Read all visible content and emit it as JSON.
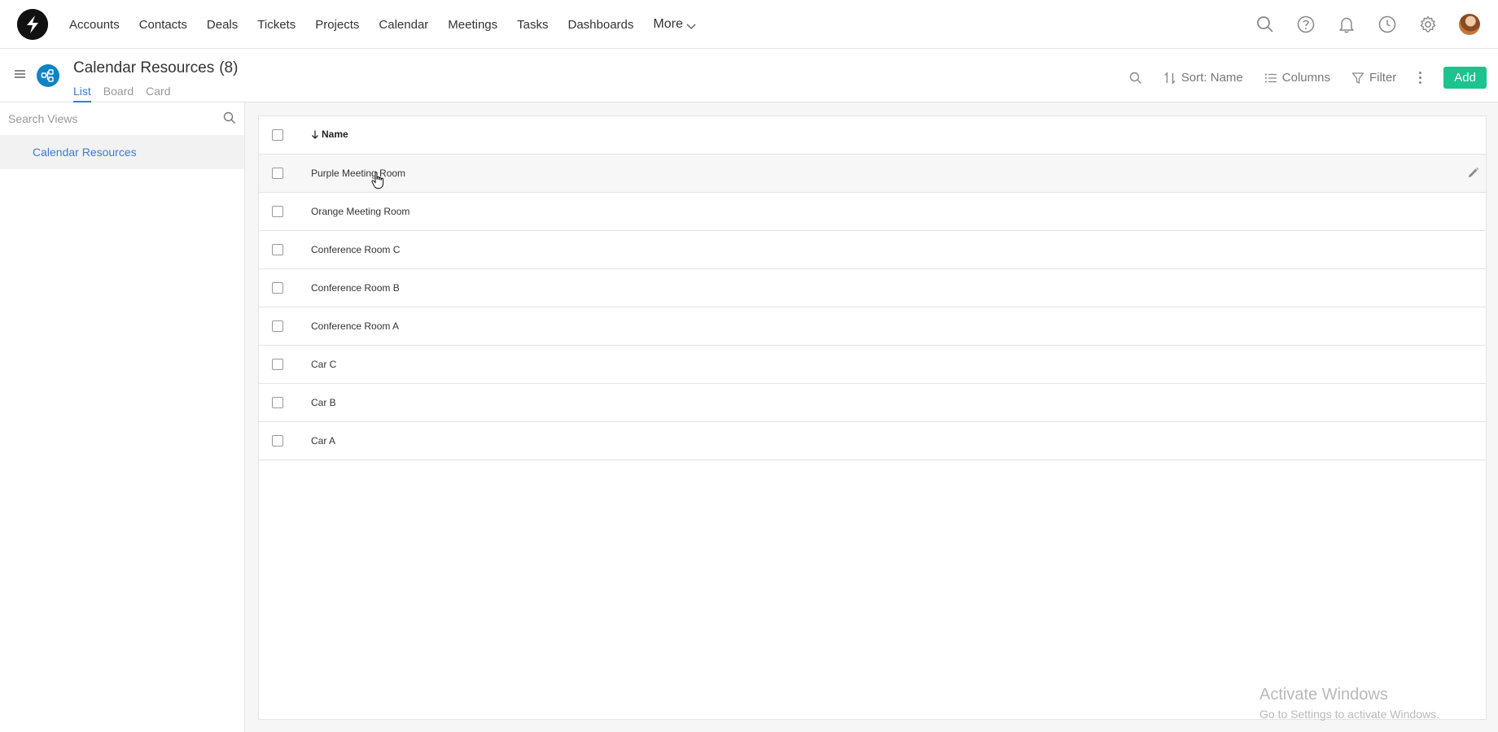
{
  "nav": {
    "items": [
      "Accounts",
      "Contacts",
      "Deals",
      "Tickets",
      "Projects",
      "Calendar",
      "Meetings",
      "Tasks",
      "Dashboards"
    ],
    "more_label": "More"
  },
  "header": {
    "title": "Calendar Resources",
    "count": "(8)",
    "tabs": [
      {
        "label": "List",
        "active": true
      },
      {
        "label": "Board",
        "active": false
      },
      {
        "label": "Card",
        "active": false
      }
    ],
    "toolbar": {
      "sort_label": "Sort: Name",
      "columns_label": "Columns",
      "filter_label": "Filter",
      "add_label": "Add"
    }
  },
  "sidebar": {
    "search_placeholder": "Search Views",
    "views": [
      "Calendar Resources"
    ]
  },
  "table": {
    "column_header": "Name",
    "rows": [
      "Purple Meeting Room",
      "Orange Meeting Room",
      "Conference Room C",
      "Conference Room B",
      "Conference Room A",
      "Car C",
      "Car B",
      "Car A"
    ]
  },
  "watermark": {
    "title": "Activate Windows",
    "subtitle": "Go to Settings to activate Windows."
  },
  "colors": {
    "accent_blue": "#3b7cd6",
    "add_green": "#1cc38e",
    "entity_icon_blue": "#0f84c4"
  }
}
